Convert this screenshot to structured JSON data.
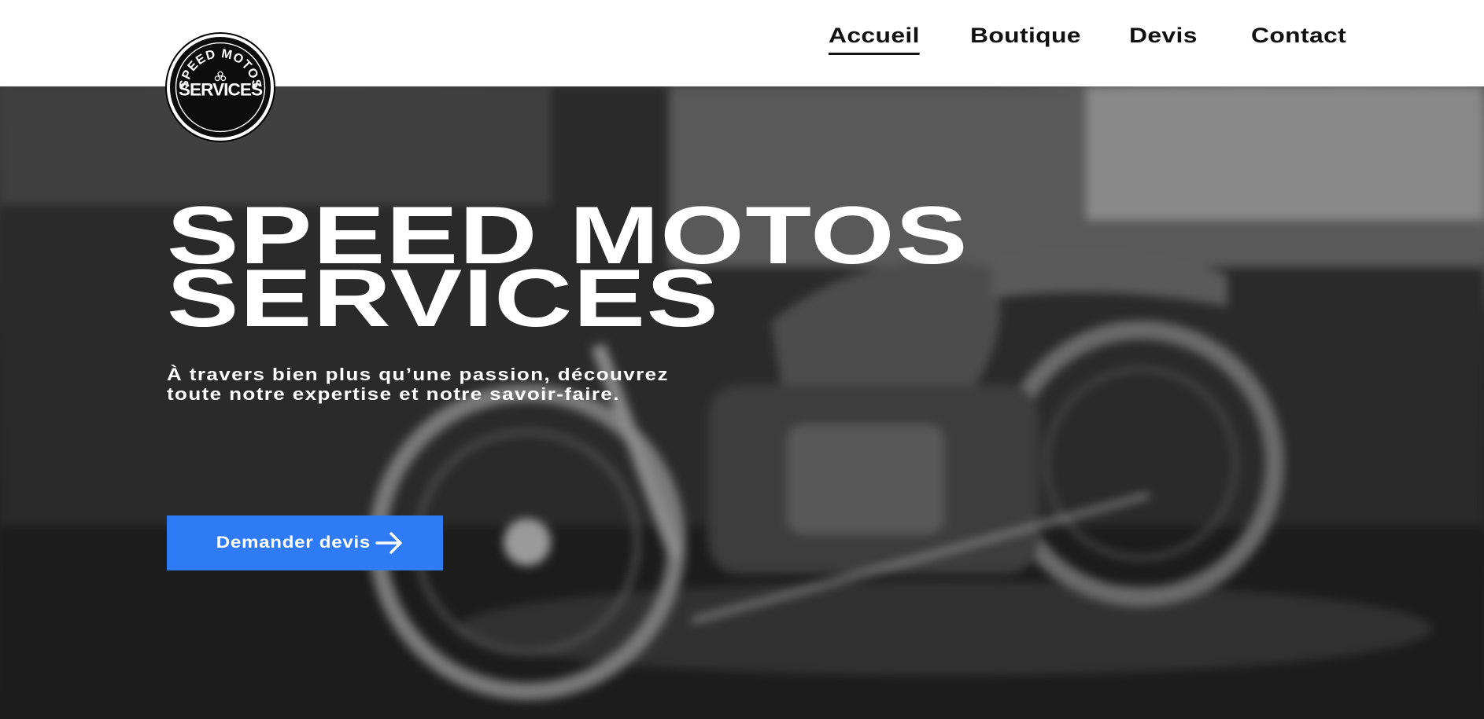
{
  "nav": {
    "items": [
      {
        "label": "Accueil",
        "active": true
      },
      {
        "label": "Boutique",
        "active": false
      },
      {
        "label": "Devis",
        "active": false
      },
      {
        "label": "Contact",
        "active": false
      }
    ]
  },
  "logo": {
    "ring_text": "SPEED MOTOS",
    "main_text": "SERVICES"
  },
  "hero": {
    "title_line1": "SPEED MOTOS",
    "title_line2": "SERVICES",
    "subtitle_line1": "À travers bien plus qu’une passion, découvrez",
    "subtitle_line2": "toute notre expertise et notre savoir-faire.",
    "cta_label": "Demander devis",
    "cta_icon": "arrow-right-icon",
    "background_image": "motorcycle-photo"
  },
  "colors": {
    "accent": "#2f7bf5",
    "header_bg": "#ffffff",
    "text_dark": "#111111"
  }
}
